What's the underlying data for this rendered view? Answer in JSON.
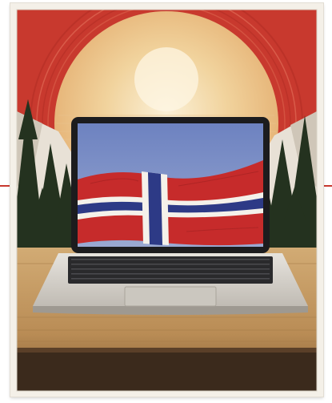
{
  "artwork": {
    "subject": "laptop-displaying-norwegian-flag-poster",
    "colors": {
      "sky_red": "#c8392e",
      "sun_glow": "#f3d9a6",
      "flag_red": "#c62b2b",
      "flag_blue": "#2d3a86",
      "flag_white": "#f4f1ea",
      "screen_sky": "#7b90c8",
      "tree_dark": "#24321f",
      "mountain": "#e8e1d6",
      "table_wood": "#c49a63",
      "laptop_silver": "#d9d6d0"
    },
    "icons": [
      "laptop-icon",
      "norway-flag-icon",
      "sun-icon",
      "pine-tree-icon",
      "mountain-icon"
    ]
  }
}
